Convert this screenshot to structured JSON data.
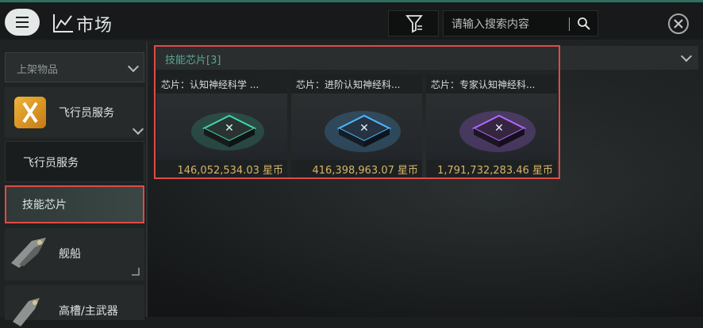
{
  "header": {
    "title": "市场",
    "search_placeholder": "请输入搜索内容"
  },
  "sidebar": {
    "section_label": "上架物品",
    "categories": [
      {
        "label": "飞行员服务",
        "icon": "pilot-service-icon"
      },
      {
        "label": "舰船",
        "icon": "ship-icon"
      },
      {
        "label": "高槽/主武器",
        "icon": "weapon-icon"
      }
    ],
    "subcategories": [
      {
        "label": "飞行员服务"
      },
      {
        "label": "技能芯片"
      }
    ]
  },
  "results": {
    "group_title": "技能芯片[3]",
    "items": [
      {
        "name": "芯片：认知神经科学 ...",
        "price": "146,052,534.03 星币",
        "color": "#3fd8b0"
      },
      {
        "name": "芯片：进阶认知神经科...",
        "price": "416,398,963.07 星币",
        "color": "#4fb8ff"
      },
      {
        "name": "芯片：专家认知神经科...",
        "price": "1,791,732,283.46 星币",
        "color": "#b468ff"
      }
    ]
  },
  "colors": {
    "accent": "#2f6f62",
    "price": "#d6b56a",
    "highlight": "#e04a48"
  }
}
